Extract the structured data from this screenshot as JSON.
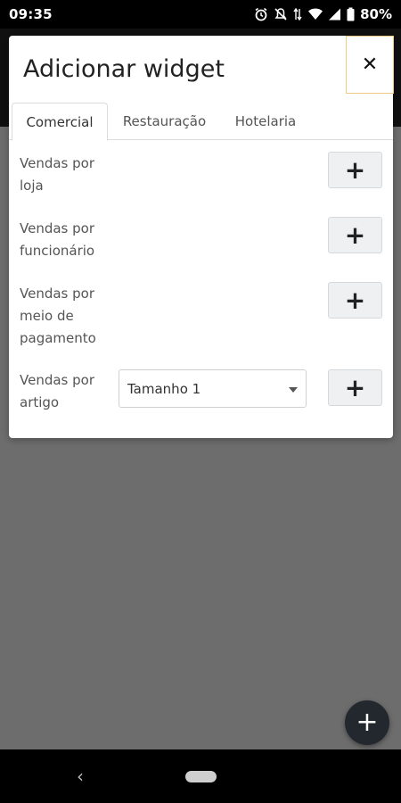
{
  "status_bar": {
    "time": "09:35",
    "battery": "80%",
    "icons": [
      "alarm-icon",
      "mute-icon",
      "data-arrows-icon",
      "wifi-icon",
      "signal-icon",
      "battery-icon"
    ]
  },
  "dialog": {
    "title": "Adicionar widget",
    "close_label": "✕",
    "tabs": [
      {
        "label": "Comercial",
        "active": true
      },
      {
        "label": "Restauração",
        "active": false
      },
      {
        "label": "Hotelaria",
        "active": false
      }
    ],
    "rows": [
      {
        "label": "Vendas por loja",
        "add_label": "+"
      },
      {
        "label": "Vendas por funcionário",
        "add_label": "+"
      },
      {
        "label": "Vendas por meio de pagamento",
        "add_label": "+"
      },
      {
        "label": "Vendas por artigo",
        "add_label": "+",
        "select_value": "Tamanho 1"
      }
    ]
  },
  "fab_label": "+",
  "nav": {
    "back_label": "‹"
  },
  "colors": {
    "fab": "#22282d",
    "close_border": "#f0c987",
    "scrim": "#6d6d6d"
  }
}
